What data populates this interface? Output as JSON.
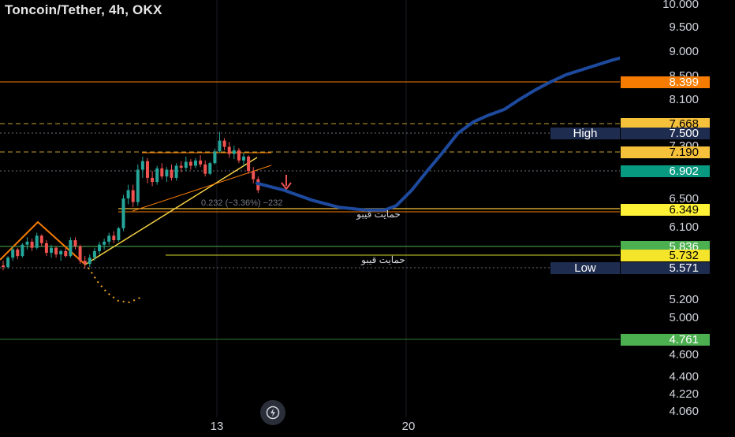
{
  "title": "Toncoin/Tether, 4h, OKX",
  "chart_data": {
    "type": "candlestick",
    "symbol": "Toncoin/Tether",
    "interval": "4h",
    "exchange": "OKX",
    "y_ticks": [
      "10.000",
      "9.500",
      "9.000",
      "8.500",
      "8.100",
      "7.300",
      "6.500",
      "6.100",
      "5.200",
      "5.000",
      "4.600",
      "4.400",
      "4.220",
      "4.060"
    ],
    "x_ticks": [
      "13",
      "20"
    ],
    "price_tags": [
      {
        "label": "8.399",
        "value": 8.399,
        "bg": "#f57c00",
        "fg": "#ffffff"
      },
      {
        "label": "7.668",
        "value": 7.668,
        "bg": "#f5c13b",
        "fg": "#000000"
      },
      {
        "label": "7.500",
        "value": 7.5,
        "bg": "#1e2c4f",
        "fg": "#ffffff",
        "note": "High"
      },
      {
        "label": "7.190",
        "value": 7.19,
        "bg": "#f5c13b",
        "fg": "#000000"
      },
      {
        "label": "6.902",
        "value": 6.902,
        "bg": "#089981",
        "fg": "#ffffff"
      },
      {
        "label": "6.349",
        "value": 6.349,
        "bg": "#fff236",
        "fg": "#000000"
      },
      {
        "label": "5.836",
        "value": 5.836,
        "bg": "#4caf50",
        "fg": "#ffffff"
      },
      {
        "label": "5.732",
        "value": 5.732,
        "bg": "#f5e52a",
        "fg": "#000000"
      },
      {
        "label": "5.571",
        "value": 5.571,
        "bg": "#1e2c4f",
        "fg": "#ffffff",
        "note": "Low"
      },
      {
        "label": "4.761",
        "value": 4.761,
        "bg": "#4caf50",
        "fg": "#ffffff"
      }
    ],
    "annotations": [
      {
        "text": "0.232 (−3.36%) −232"
      },
      {
        "text": "حمایت قیبو"
      },
      {
        "text": "حمایت قیبو"
      }
    ],
    "candles": [
      [
        5.6,
        5.66,
        5.54,
        5.58
      ],
      [
        5.58,
        5.72,
        5.56,
        5.7
      ],
      [
        5.7,
        5.84,
        5.66,
        5.8
      ],
      [
        5.8,
        5.82,
        5.68,
        5.72
      ],
      [
        5.72,
        5.88,
        5.7,
        5.86
      ],
      [
        5.86,
        5.96,
        5.8,
        5.9
      ],
      [
        5.9,
        5.94,
        5.78,
        5.82
      ],
      [
        5.82,
        6.02,
        5.8,
        5.98
      ],
      [
        5.98,
        6.0,
        5.84,
        5.88
      ],
      [
        5.88,
        5.92,
        5.72,
        5.76
      ],
      [
        5.76,
        5.86,
        5.7,
        5.82
      ],
      [
        5.82,
        5.84,
        5.7,
        5.74
      ],
      [
        5.74,
        5.8,
        5.66,
        5.78
      ],
      [
        5.78,
        5.82,
        5.7,
        5.72
      ],
      [
        5.72,
        5.96,
        5.7,
        5.92
      ],
      [
        5.92,
        5.96,
        5.8,
        5.84
      ],
      [
        5.84,
        5.86,
        5.62,
        5.66
      ],
      [
        5.66,
        5.72,
        5.56,
        5.62
      ],
      [
        5.62,
        5.74,
        5.58,
        5.7
      ],
      [
        5.7,
        5.82,
        5.66,
        5.78
      ],
      [
        5.78,
        5.9,
        5.74,
        5.86
      ],
      [
        5.86,
        5.94,
        5.8,
        5.9
      ],
      [
        5.9,
        6.02,
        5.86,
        5.98
      ],
      [
        5.98,
        6.04,
        5.88,
        5.92
      ],
      [
        5.92,
        6.1,
        5.9,
        6.08
      ],
      [
        6.08,
        6.55,
        6.04,
        6.5
      ],
      [
        6.5,
        6.7,
        6.42,
        6.62
      ],
      [
        6.62,
        6.7,
        6.38,
        6.45
      ],
      [
        6.45,
        7.0,
        6.4,
        6.92
      ],
      [
        6.92,
        7.12,
        6.8,
        7.05
      ],
      [
        7.05,
        7.1,
        6.72,
        6.8
      ],
      [
        6.8,
        6.9,
        6.68,
        6.74
      ],
      [
        6.74,
        6.98,
        6.7,
        6.94
      ],
      [
        6.94,
        7.02,
        6.78,
        6.82
      ],
      [
        6.82,
        6.96,
        6.74,
        6.92
      ],
      [
        6.92,
        7.0,
        6.76,
        6.8
      ],
      [
        6.8,
        7.02,
        6.76,
        6.98
      ],
      [
        6.98,
        7.05,
        6.88,
        6.95
      ],
      [
        6.95,
        7.12,
        6.9,
        7.04
      ],
      [
        7.04,
        7.08,
        6.92,
        6.98
      ],
      [
        6.98,
        7.1,
        6.94,
        7.06
      ],
      [
        7.06,
        7.14,
        6.96,
        7.0
      ],
      [
        7.0,
        7.06,
        6.82,
        6.86
      ],
      [
        6.86,
        7.04,
        6.84,
        7.02
      ],
      [
        7.02,
        7.25,
        7.0,
        7.2
      ],
      [
        7.2,
        7.52,
        7.18,
        7.38
      ],
      [
        7.38,
        7.42,
        7.22,
        7.28
      ],
      [
        7.28,
        7.36,
        7.1,
        7.16
      ],
      [
        7.16,
        7.3,
        7.08,
        7.22
      ],
      [
        7.22,
        7.26,
        7.02,
        7.06
      ],
      [
        7.06,
        7.18,
        6.98,
        7.12
      ],
      [
        7.12,
        7.14,
        6.86,
        6.9
      ],
      [
        6.9,
        6.96,
        6.72,
        6.78
      ],
      [
        6.78,
        6.82,
        6.58,
        6.62
      ]
    ],
    "projection": [
      [
        0,
        6.72
      ],
      [
        14,
        6.62
      ],
      [
        28,
        6.48
      ],
      [
        42,
        6.38
      ],
      [
        56,
        6.34
      ],
      [
        66,
        6.34
      ],
      [
        72,
        6.4
      ],
      [
        80,
        6.62
      ],
      [
        88,
        6.9
      ],
      [
        96,
        7.18
      ],
      [
        104,
        7.5
      ],
      [
        112,
        7.7
      ],
      [
        120,
        7.82
      ],
      [
        128,
        7.92
      ],
      [
        136,
        8.1
      ],
      [
        144,
        8.26
      ],
      [
        152,
        8.4
      ],
      [
        160,
        8.52
      ],
      [
        168,
        8.62
      ],
      [
        176,
        8.72
      ],
      [
        184,
        8.82
      ],
      [
        188,
        8.86
      ]
    ]
  }
}
